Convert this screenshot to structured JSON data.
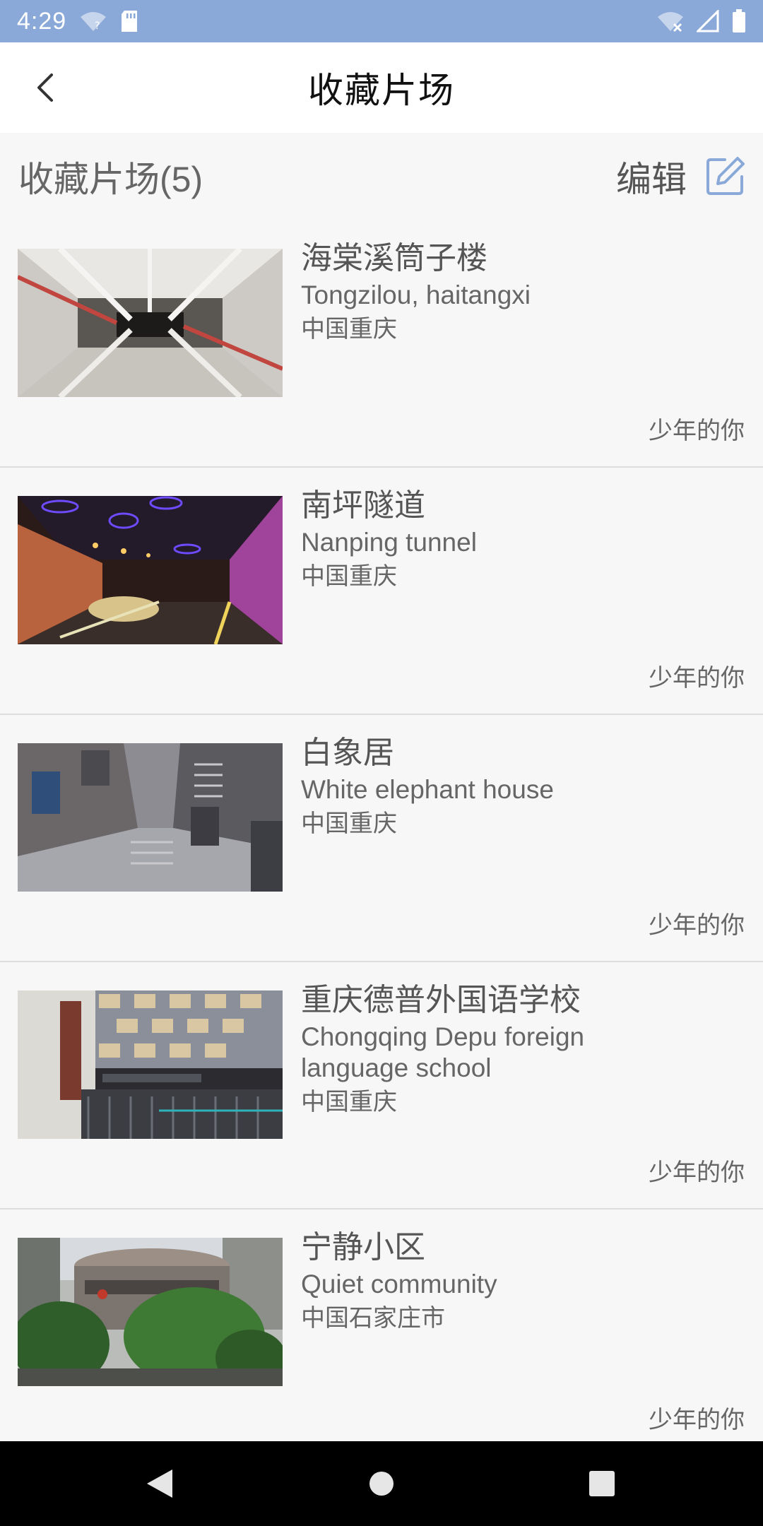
{
  "status_bar": {
    "time": "4:29",
    "icons_left": [
      "wifi-question-icon",
      "sd-card-icon"
    ],
    "icons_right": [
      "wifi-off-icon",
      "signal-icon",
      "battery-icon"
    ],
    "background": "#8aa9d8"
  },
  "app_bar": {
    "title": "收藏片场",
    "back_icon": "chevron-left-icon"
  },
  "header": {
    "title": "收藏片场(5)",
    "edit_label": "编辑",
    "edit_icon": "edit-pencil-icon",
    "accent": "#8aa9d8"
  },
  "items": [
    {
      "name": "海棠溪筒子楼",
      "english": "Tongzilou, haitangxi",
      "location": "中国重庆",
      "tag": "少年的你",
      "image": "tongzilou-stairwell-photo"
    },
    {
      "name": "南坪隧道",
      "english": "Nanping tunnel",
      "location": "中国重庆",
      "tag": "少年的你",
      "image": "tunnel-photo"
    },
    {
      "name": "白象居",
      "english": "White elephant house",
      "location": "中国重庆",
      "tag": "少年的你",
      "image": "stairs-alley-photo"
    },
    {
      "name": "重庆德普外国语学校",
      "english": "Chongqing Depu foreign language school",
      "location": "中国重庆",
      "tag": "少年的你",
      "image": "school-building-photo"
    },
    {
      "name": "宁静小区",
      "english": "Quiet community",
      "location": "中国石家庄市",
      "tag": "少年的你",
      "image": "community-photo"
    }
  ],
  "nav_bar": {
    "back": "nav-back-icon",
    "home": "nav-home-icon",
    "recents": "nav-recents-icon"
  }
}
